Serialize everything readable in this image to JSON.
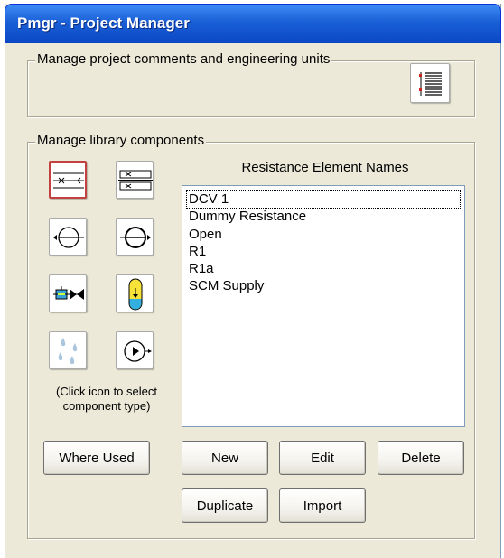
{
  "window": {
    "title": "Pmgr - Project Manager"
  },
  "comments_group": {
    "label": "Manage project comments and engineering units",
    "icon": "notes-list-icon"
  },
  "library_group": {
    "label": "Manage library components",
    "icons": [
      {
        "name": "resistance-element-icon",
        "selected": true
      },
      {
        "name": "multi-resistance-icon",
        "selected": false
      },
      {
        "name": "pump-left-icon",
        "selected": false
      },
      {
        "name": "pump-right-icon",
        "selected": false
      },
      {
        "name": "valve-actuator-icon",
        "selected": false
      },
      {
        "name": "accumulator-icon",
        "selected": false
      },
      {
        "name": "droplets-icon",
        "selected": false
      },
      {
        "name": "circular-flow-icon",
        "selected": false
      }
    ],
    "hint_line1": "(Click icon to select",
    "hint_line2": "component type)",
    "list_header": "Resistance Element Names",
    "items": [
      "DCV 1",
      "Dummy Resistance",
      "Open",
      "R1",
      "R1a",
      "SCM Supply"
    ],
    "focused_index": 0
  },
  "buttons": {
    "where_used": "Where Used",
    "new": "New",
    "edit": "Edit",
    "delete": "Delete",
    "duplicate": "Duplicate",
    "import": "Import"
  },
  "colors": {
    "title_bar": "#0a47c4",
    "dialog_bg": "#ece9d8",
    "selected_icon_border": "#c44040"
  }
}
